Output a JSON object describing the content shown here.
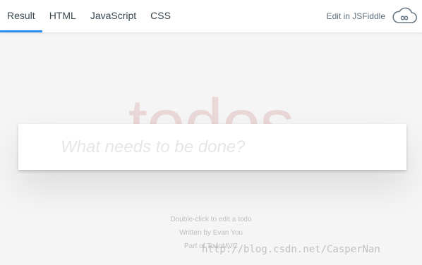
{
  "tabs": [
    {
      "label": "Result",
      "active": true
    },
    {
      "label": "HTML",
      "active": false
    },
    {
      "label": "JavaScript",
      "active": false
    },
    {
      "label": "CSS",
      "active": false
    }
  ],
  "edit_link": {
    "label": "Edit in JSFiddle",
    "icon": "cloud-infinity-icon"
  },
  "todo_app": {
    "title": "todos",
    "new_todo": {
      "value": "",
      "placeholder": "What needs to be done?"
    }
  },
  "info": {
    "hint": "Double-click to edit a todo",
    "author": "Written by Evan You",
    "part_of": "Part of TodoMVC"
  },
  "watermark": "http://blog.csdn.net/CasperNan",
  "colors": {
    "tab_active_underline": "#2c8ff0",
    "title_color": "rgba(175,47,47,0.15)",
    "page_background": "#f5f5f5"
  }
}
